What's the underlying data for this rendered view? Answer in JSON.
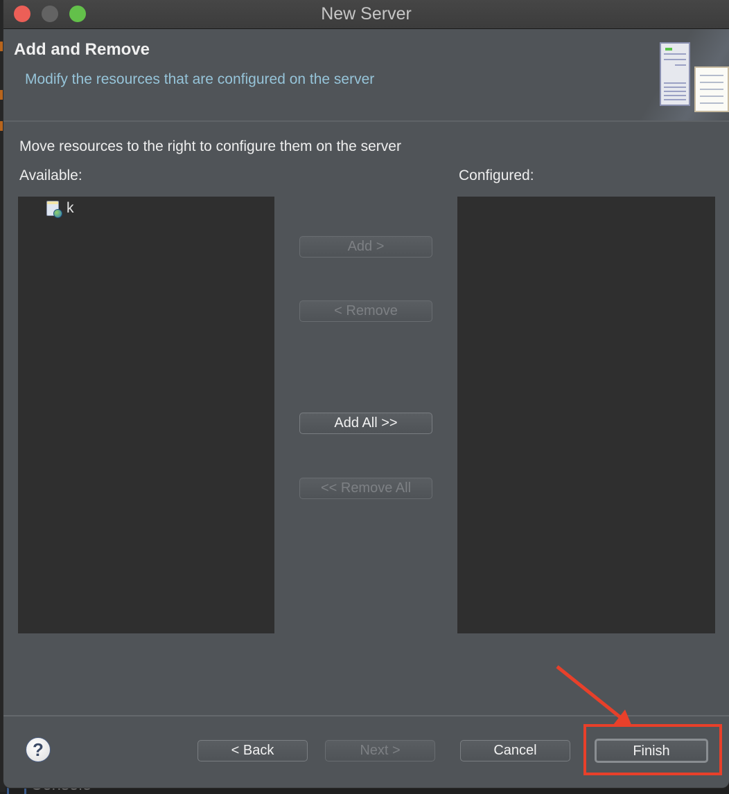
{
  "window": {
    "title": "New Server",
    "controls": [
      "close",
      "minimize",
      "maximize"
    ]
  },
  "banner": {
    "title": "Add and Remove",
    "description": "Modify the resources that are configured on the server",
    "graphic_icon": "server-wizard-banner-icon"
  },
  "body": {
    "instruction": "Move resources to the right to configure them on the server",
    "available": {
      "label": "Available:",
      "items": [
        {
          "label": "k",
          "icon": "web-project-icon"
        }
      ]
    },
    "configured": {
      "label": "Configured:",
      "items": []
    },
    "buttons": {
      "add": {
        "label": "Add >",
        "enabled": false
      },
      "remove": {
        "label": "< Remove",
        "enabled": false
      },
      "add_all": {
        "label": "Add All >>",
        "enabled": true
      },
      "remove_all": {
        "label": "<< Remove All",
        "enabled": false
      }
    }
  },
  "footer": {
    "help": "?",
    "back": {
      "label": "< Back",
      "enabled": true
    },
    "next": {
      "label": "Next >",
      "enabled": false
    },
    "cancel": {
      "label": "Cancel",
      "enabled": true
    },
    "finish": {
      "label": "Finish",
      "enabled": true
    }
  },
  "background": {
    "partial_label": "Console"
  },
  "annotation": {
    "color": "#e8402a",
    "target": "finish-button"
  }
}
